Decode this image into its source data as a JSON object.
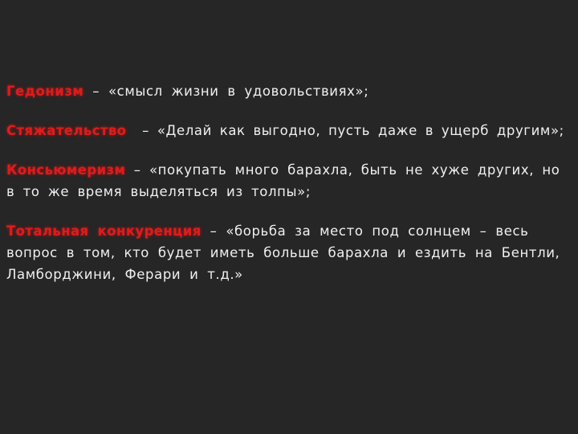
{
  "slide": {
    "background_color": "#262626",
    "accent_color": "#E01B1B",
    "text_color": "#F0F0F0",
    "items": [
      {
        "term": "Гедонизм",
        "separator": " – ",
        "definition": "«смысл жизни в удовольствиях»;"
      },
      {
        "term": "Стяжательство",
        "separator": "  – ",
        "definition": "«Делай как выгодно, пусть даже в ущерб другим»;"
      },
      {
        "term": "Консьюмеризм",
        "separator": " – ",
        "definition": "«покупать много барахла, быть не хуже других, но в то же время выделяться из толпы»;"
      },
      {
        "term": "Тотальная конкуренция",
        "separator": " – ",
        "definition": "«борьба за место под солнцем – весь вопрос в том, кто будет иметь больше барахла и ездить на Бентли, Ламборджини, Ферари и т.д.»"
      }
    ]
  }
}
